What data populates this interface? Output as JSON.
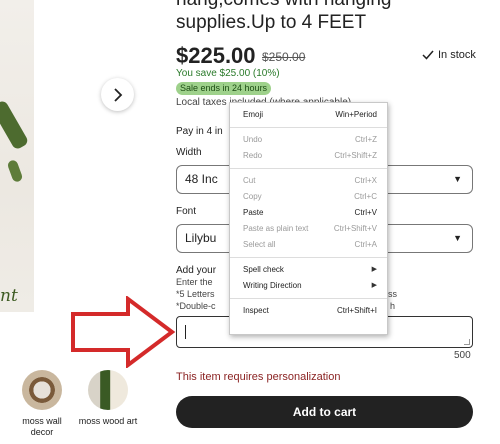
{
  "product": {
    "title": "hang,comes with hanging supplies.Up to 4 FEET",
    "price": "$225.00",
    "old_price": "$250.00",
    "stock": "In stock",
    "save": "You save $25.00 (10%)",
    "sale_badge": "Sale ends in 24 hours",
    "tax": "Local taxes included (where applicable)",
    "pay": "Pay in 4 in",
    "image_script": "nt"
  },
  "options": {
    "width_label": "Width",
    "width_value": "48 Inc",
    "font_label": "Font",
    "font_value": "Lilybu"
  },
  "personalization": {
    "heading": "Add your",
    "line1": "Enter the",
    "line1_end": "ss",
    "line2": "*5 Letters",
    "line2_end": "ss",
    "line3": "*Double-c",
    "line3_end": "h",
    "char_count": "500",
    "error": "This item requires personalization"
  },
  "cart": {
    "label": "Add to cart"
  },
  "thumbnails": [
    {
      "label": "moss wall decor"
    },
    {
      "label": "moss wood art"
    }
  ],
  "context_menu": {
    "items": [
      {
        "label": "Emoji",
        "shortcut": "Win+Period",
        "enabled": true
      },
      {
        "label": "Undo",
        "shortcut": "Ctrl+Z",
        "enabled": false
      },
      {
        "label": "Redo",
        "shortcut": "Ctrl+Shift+Z",
        "enabled": false
      },
      {
        "label": "Cut",
        "shortcut": "Ctrl+X",
        "enabled": false
      },
      {
        "label": "Copy",
        "shortcut": "Ctrl+C",
        "enabled": false
      },
      {
        "label": "Paste",
        "shortcut": "Ctrl+V",
        "enabled": true
      },
      {
        "label": "Paste as plain text",
        "shortcut": "Ctrl+Shift+V",
        "enabled": false
      },
      {
        "label": "Select all",
        "shortcut": "Ctrl+A",
        "enabled": false
      },
      {
        "label": "Spell check",
        "shortcut": "",
        "enabled": true,
        "submenu": true
      },
      {
        "label": "Writing Direction",
        "shortcut": "",
        "enabled": true,
        "submenu": true
      },
      {
        "label": "Inspect",
        "shortcut": "Ctrl+Shift+I",
        "enabled": true
      }
    ]
  },
  "colors": {
    "accent": "#222222",
    "save_green": "#2a7a2a",
    "badge_green": "#9ed18b",
    "error_red": "#8b2323",
    "arrow_red": "#d42a2a"
  }
}
